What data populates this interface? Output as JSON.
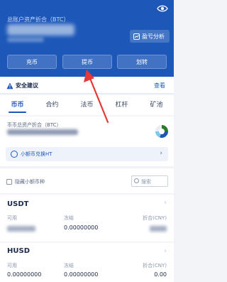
{
  "header": {
    "total_label": "总账户资产折合（BTC）",
    "analysis_label": "盈亏分析",
    "buttons": [
      "充币",
      "提币",
      "划转"
    ]
  },
  "security": {
    "title": "安全建议",
    "view_label": "查看"
  },
  "tabs": [
    "币币",
    "合约",
    "法币",
    "杠杆",
    "矿池"
  ],
  "spot": {
    "label": "币币总资产折合（BTC）",
    "exchange_label": "小额币兑换HT"
  },
  "filter": {
    "hide_small_label": "隐藏小额币种",
    "search_placeholder": "搜索"
  },
  "columns": {
    "available": "可用",
    "frozen": "冻结",
    "equivalent": "折合(CNY)"
  },
  "coins": [
    {
      "name": "USDT",
      "available": "",
      "frozen": "0.00000000",
      "equivalent": ""
    },
    {
      "name": "HUSD",
      "available": "0.00000000",
      "frozen": "0.00000000",
      "equivalent": "0.00"
    }
  ],
  "colors": {
    "brand_blue": "#1d58b8",
    "annotation_red": "#e53935"
  }
}
